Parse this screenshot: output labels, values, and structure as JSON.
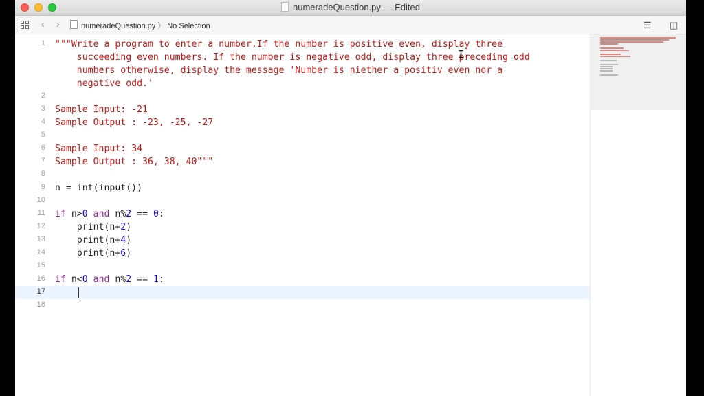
{
  "window": {
    "title": "numeradeQuestion.py — Edited"
  },
  "pathbar": {
    "back_icon": "chevron-left-icon",
    "forward_icon": "chevron-right-icon",
    "filename": "numeradeQuestion.py",
    "separator": "〉",
    "selection": "No Selection"
  },
  "editor": {
    "current_line": 17,
    "lines": [
      {
        "n": "1",
        "text": "\"\"\"Write a program to enter a number.If the number is positive even, display three"
      },
      {
        "n": "",
        "text": "    succeeding even numbers. If the number is negative odd, display three preceding odd"
      },
      {
        "n": "",
        "text": "    numbers otherwise, display the message 'Number is niether a positiv even nor a"
      },
      {
        "n": "",
        "text": "    negative odd.'"
      },
      {
        "n": "2",
        "text": ""
      },
      {
        "n": "3",
        "text": "Sample Input: -21"
      },
      {
        "n": "4",
        "text": "Sample Output : -23, -25, -27"
      },
      {
        "n": "5",
        "text": ""
      },
      {
        "n": "6",
        "text": "Sample Input: 34"
      },
      {
        "n": "7",
        "text": "Sample Output : 36, 38, 40\"\"\""
      },
      {
        "n": "8",
        "text": ""
      },
      {
        "n": "9",
        "text": "n = int(input())"
      },
      {
        "n": "10",
        "text": ""
      },
      {
        "n": "11",
        "text": "if n>0 and n%2 == 0:"
      },
      {
        "n": "12",
        "text": "    print(n+2)"
      },
      {
        "n": "13",
        "text": "    print(n+4)"
      },
      {
        "n": "14",
        "text": "    print(n+6)"
      },
      {
        "n": "15",
        "text": ""
      },
      {
        "n": "16",
        "text": "if n<0 and n%2 == 1:"
      },
      {
        "n": "17",
        "text": "    "
      },
      {
        "n": "18",
        "text": ""
      }
    ]
  },
  "colors": {
    "string": "#c41a16",
    "keyword": "#9b2393",
    "number": "#1c00cf",
    "current_line": "#ecf5ff"
  }
}
